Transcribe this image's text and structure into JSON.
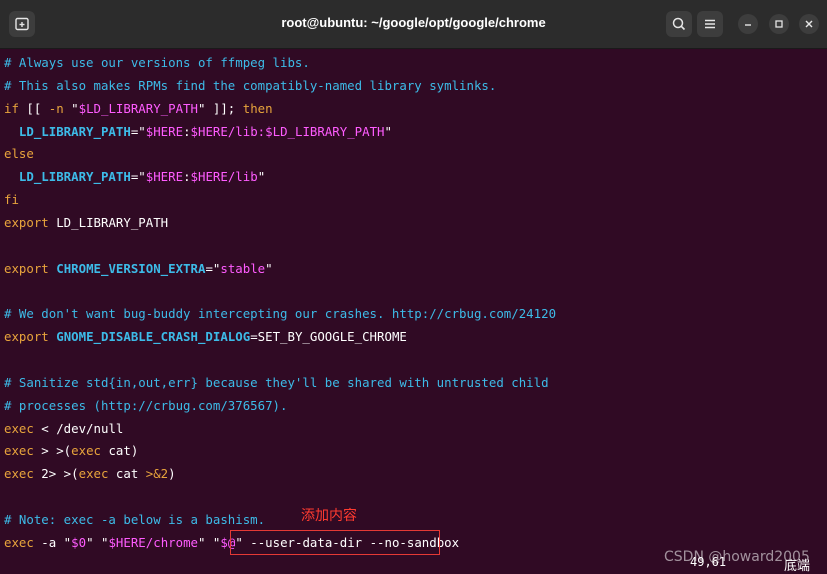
{
  "window": {
    "title": "root@ubuntu: ~/google/opt/google/chrome",
    "icons": [
      "new-tab-icon",
      "search-icon",
      "menu-icon",
      "minimize-icon",
      "maximize-icon",
      "close-icon"
    ]
  },
  "colors": {
    "background": "#300a24",
    "comment": "#3dbbe8",
    "keyword": "#e8a43c",
    "string": "#ff5cff",
    "variable": "#3dbbe8",
    "annotation": "#ff3b30"
  },
  "lines": [
    [
      {
        "t": "# Always use our versions of ffmpeg libs.",
        "c": "comment"
      }
    ],
    [
      {
        "t": "# This also makes RPMs find the compatibly-named library symlinks.",
        "c": "comment"
      }
    ],
    [
      {
        "t": "if",
        "c": "kw"
      },
      {
        "t": " [[ ",
        "c": "plain"
      },
      {
        "t": "-n",
        "c": "kw"
      },
      {
        "t": " \"",
        "c": "plain"
      },
      {
        "t": "$LD_LIBRARY_PATH",
        "c": "str"
      },
      {
        "t": "\" ]]; ",
        "c": "plain"
      },
      {
        "t": "then",
        "c": "kw"
      }
    ],
    [
      {
        "t": "  LD_LIBRARY_PATH",
        "c": "var"
      },
      {
        "t": "=\"",
        "c": "plain"
      },
      {
        "t": "$HERE",
        "c": "str"
      },
      {
        "t": ":",
        "c": "plain"
      },
      {
        "t": "$HERE",
        "c": "str"
      },
      {
        "t": "/lib:",
        "c": "str"
      },
      {
        "t": "$LD_LIBRARY_PATH",
        "c": "str"
      },
      {
        "t": "\"",
        "c": "plain"
      }
    ],
    [
      {
        "t": "else",
        "c": "kw"
      }
    ],
    [
      {
        "t": "  LD_LIBRARY_PATH",
        "c": "var"
      },
      {
        "t": "=\"",
        "c": "plain"
      },
      {
        "t": "$HERE",
        "c": "str"
      },
      {
        "t": ":",
        "c": "plain"
      },
      {
        "t": "$HERE",
        "c": "str"
      },
      {
        "t": "/lib",
        "c": "str"
      },
      {
        "t": "\"",
        "c": "plain"
      }
    ],
    [
      {
        "t": "fi",
        "c": "kw"
      }
    ],
    [
      {
        "t": "export",
        "c": "kw"
      },
      {
        "t": " LD_LIBRARY_PATH",
        "c": "plain"
      }
    ],
    [],
    [
      {
        "t": "export",
        "c": "kw"
      },
      {
        "t": " ",
        "c": "plain"
      },
      {
        "t": "CHROME_VERSION_EXTRA",
        "c": "var"
      },
      {
        "t": "=\"",
        "c": "plain"
      },
      {
        "t": "stable",
        "c": "str"
      },
      {
        "t": "\"",
        "c": "plain"
      }
    ],
    [],
    [
      {
        "t": "# We don't want bug-buddy intercepting our crashes. http://crbug.com/24120",
        "c": "comment"
      }
    ],
    [
      {
        "t": "export",
        "c": "kw"
      },
      {
        "t": " ",
        "c": "plain"
      },
      {
        "t": "GNOME_DISABLE_CRASH_DIALOG",
        "c": "var"
      },
      {
        "t": "=SET_BY_GOOGLE_CHROME",
        "c": "plain"
      }
    ],
    [],
    [
      {
        "t": "# Sanitize std{in,out,err} because they'll be shared with untrusted child",
        "c": "comment"
      }
    ],
    [
      {
        "t": "# processes (http://crbug.com/376567).",
        "c": "comment"
      }
    ],
    [
      {
        "t": "exec",
        "c": "kw"
      },
      {
        "t": " < /dev/null",
        "c": "plain"
      }
    ],
    [
      {
        "t": "exec",
        "c": "kw"
      },
      {
        "t": " > >(",
        "c": "plain"
      },
      {
        "t": "exec",
        "c": "kw"
      },
      {
        "t": " cat)",
        "c": "plain"
      }
    ],
    [
      {
        "t": "exec",
        "c": "kw"
      },
      {
        "t": " 2> >(",
        "c": "plain"
      },
      {
        "t": "exec",
        "c": "kw"
      },
      {
        "t": " cat ",
        "c": "plain"
      },
      {
        "t": ">&2",
        "c": "kw"
      },
      {
        "t": ")",
        "c": "plain"
      }
    ],
    [],
    [
      {
        "t": "# Note: exec -a below is a bashism.",
        "c": "comment"
      }
    ],
    [
      {
        "t": "exec",
        "c": "kw"
      },
      {
        "t": " -a \"",
        "c": "plain"
      },
      {
        "t": "$0",
        "c": "str"
      },
      {
        "t": "\" \"",
        "c": "plain"
      },
      {
        "t": "$HERE",
        "c": "str"
      },
      {
        "t": "/chrome",
        "c": "str"
      },
      {
        "t": "\" \"",
        "c": "plain"
      },
      {
        "t": "$@",
        "c": "str"
      },
      {
        "t": "\" --user-data-dir --no-sandbox",
        "c": "plain"
      }
    ]
  ],
  "annotation": "添加内容",
  "status": {
    "position": "49,61",
    "end_label": "底端"
  },
  "watermark": "CSDN @howard2005"
}
